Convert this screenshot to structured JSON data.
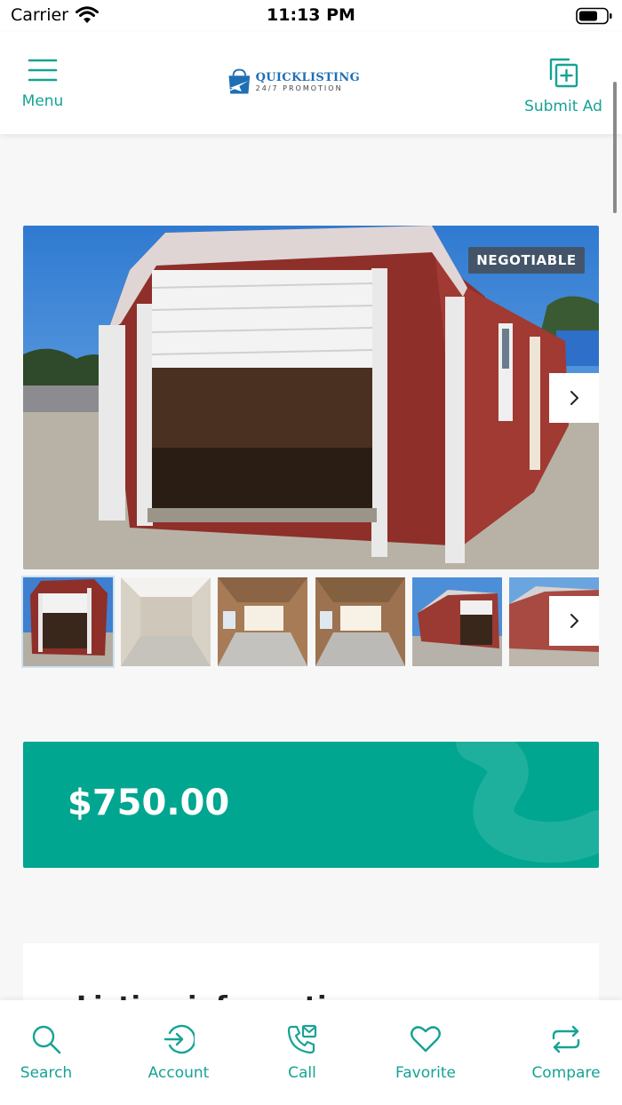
{
  "status_bar": {
    "carrier": "Carrier",
    "time": "11:13 PM"
  },
  "header": {
    "menu_label": "Menu",
    "submit_label": "Submit Ad",
    "logo": {
      "main": "QUICKLISTING",
      "sub": "24/7 PROMOTION"
    }
  },
  "listing": {
    "badge": "NEGOTIABLE",
    "price": "$750.00",
    "info_title": "Listing information"
  },
  "tabs": [
    {
      "label": "Search",
      "icon": "search-icon"
    },
    {
      "label": "Account",
      "icon": "login-icon"
    },
    {
      "label": "Call",
      "icon": "phone-icon"
    },
    {
      "label": "Favorite",
      "icon": "heart-icon"
    },
    {
      "label": "Compare",
      "icon": "repeat-icon"
    }
  ],
  "colors": {
    "accent": "#16a394",
    "price_background": "#00a690",
    "badge_background": "#464e5a"
  }
}
